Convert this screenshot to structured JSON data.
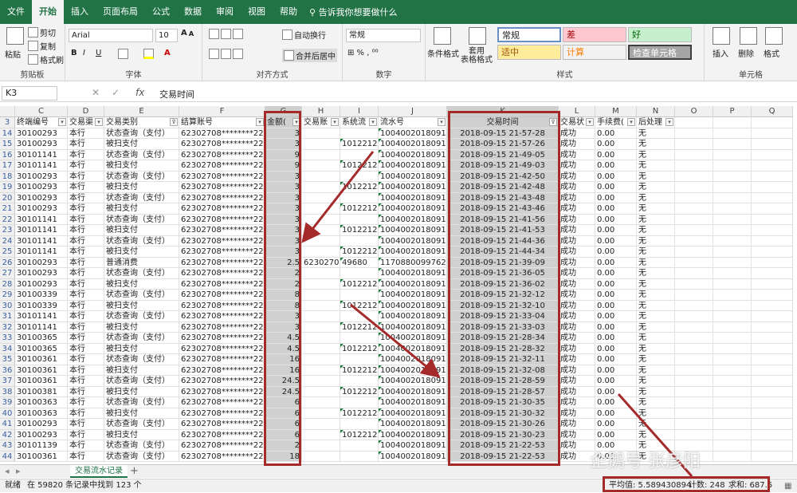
{
  "menu": {
    "tabs": [
      "文件",
      "开始",
      "插入",
      "页面布局",
      "公式",
      "数据",
      "审阅",
      "视图",
      "帮助"
    ],
    "active": 1,
    "tellme": "告诉我你想要做什么"
  },
  "ribbon": {
    "clipboard": {
      "paste": "粘贴",
      "cut": "剪切",
      "copy": "复制",
      "painter": "格式刷",
      "label": "剪贴板"
    },
    "font": {
      "name": "Arial",
      "size": "10",
      "label": "字体",
      "bold": "B",
      "italic": "I",
      "underline": "U"
    },
    "alignment": {
      "wrap": "自动换行",
      "merge": "合并后居中",
      "label": "对齐方式"
    },
    "number": {
      "format": "常规",
      "label": "数字"
    },
    "styles": {
      "cond": "条件格式",
      "table": "套用\n表格格式",
      "normal": "常规",
      "bad": "差",
      "good": "好",
      "neutral": "适中",
      "calc": "计算",
      "check": "检查单元格",
      "label": "样式"
    },
    "cells": {
      "insert": "插入",
      "delete": "删除",
      "format": "格式",
      "label": "单元格"
    }
  },
  "formula_bar": {
    "name_box": "K3",
    "fx": "fx",
    "content": "交易时间"
  },
  "columns": [
    {
      "letter": "C",
      "width": 66
    },
    {
      "letter": "D",
      "width": 46
    },
    {
      "letter": "E",
      "width": 94
    },
    {
      "letter": "F",
      "width": 108
    },
    {
      "letter": "G",
      "width": 46
    },
    {
      "letter": "H",
      "width": 48
    },
    {
      "letter": "I",
      "width": 48
    },
    {
      "letter": "J",
      "width": 86
    },
    {
      "letter": "K",
      "width": 140
    },
    {
      "letter": "L",
      "width": 46
    },
    {
      "letter": "M",
      "width": 52
    },
    {
      "letter": "N",
      "width": 48
    },
    {
      "letter": "O",
      "width": 48
    },
    {
      "letter": "P",
      "width": 48
    },
    {
      "letter": "Q",
      "width": 52
    }
  ],
  "header_row": {
    "row": "3",
    "cells": [
      "终端编号",
      "交易渠",
      "交易类别",
      "结算账号",
      "金额(",
      "交易账",
      "系统流",
      "流水号",
      "交易时间",
      "交易状",
      "手续费(",
      "后处理",
      "",
      "",
      ""
    ]
  },
  "rows": [
    {
      "r": "14",
      "c": [
        "30100293",
        "本行",
        "状态查询（支付）",
        "62302708********228",
        "3",
        "",
        "",
        "10040020180915",
        "2018-09-15 21-57-28",
        "成功",
        "0.00",
        "无"
      ]
    },
    {
      "r": "15",
      "c": [
        "30100293",
        "本行",
        "被扫支付",
        "62302708********228",
        "3",
        "",
        "10122120",
        "10040020180915",
        "2018-09-15 21-57-26",
        "成功",
        "0.00",
        "无"
      ]
    },
    {
      "r": "16",
      "c": [
        "30101141",
        "本行",
        "状态查询（支付）",
        "62302708********228",
        "9",
        "",
        "",
        "10040020180915",
        "2018-09-15 21-49-05",
        "成功",
        "0.00",
        "无"
      ]
    },
    {
      "r": "17",
      "c": [
        "30101141",
        "本行",
        "被扫支付",
        "62302708********228",
        "9",
        "",
        "10122120",
        "10040020180915",
        "2018-09-15 21-49-03",
        "成功",
        "0.00",
        "无"
      ]
    },
    {
      "r": "18",
      "c": [
        "30100293",
        "本行",
        "状态查询（支付）",
        "62302708********228",
        "3",
        "",
        "",
        "10040020180915",
        "2018-09-15 21-42-50",
        "成功",
        "0.00",
        "无"
      ]
    },
    {
      "r": "19",
      "c": [
        "30100293",
        "本行",
        "被扫支付",
        "62302708********228",
        "3",
        "",
        "10122120",
        "10040020180915",
        "2018-09-15 21-42-48",
        "成功",
        "0.00",
        "无"
      ]
    },
    {
      "r": "20",
      "c": [
        "30100293",
        "本行",
        "状态查询（支付）",
        "62302708********228",
        "3",
        "",
        "",
        "10040020180915",
        "2018-09-15 21-43-48",
        "成功",
        "0.00",
        "无"
      ]
    },
    {
      "r": "21",
      "c": [
        "30100293",
        "本行",
        "被扫支付",
        "62302708********228",
        "3",
        "",
        "10122120",
        "10040020180915",
        "2018-09-15 21-43-46",
        "成功",
        "0.00",
        "无"
      ]
    },
    {
      "r": "22",
      "c": [
        "30101141",
        "本行",
        "状态查询（支付）",
        "62302708********228",
        "3",
        "",
        "",
        "10040020180915",
        "2018-09-15 21-41-56",
        "成功",
        "0.00",
        "无"
      ]
    },
    {
      "r": "23",
      "c": [
        "30101141",
        "本行",
        "被扫支付",
        "62302708********228",
        "3",
        "",
        "10122120",
        "10040020180915",
        "2018-09-15 21-41-53",
        "成功",
        "0.00",
        "无"
      ]
    },
    {
      "r": "24",
      "c": [
        "30101141",
        "本行",
        "状态查询（支付）",
        "62302708********228",
        "3",
        "",
        "",
        "10040020180915",
        "2018-09-15 21-44-36",
        "成功",
        "0.00",
        "无"
      ]
    },
    {
      "r": "25",
      "c": [
        "30101141",
        "本行",
        "被扫支付",
        "62302708********228",
        "3",
        "",
        "10122120",
        "10040020180915",
        "2018-09-15 21-44-34",
        "成功",
        "0.00",
        "无"
      ]
    },
    {
      "r": "26",
      "c": [
        "30100293",
        "本行",
        "普通消费",
        "62302708********228",
        "2.5",
        "62302708",
        "49680",
        "117088009976201",
        "2018-09-15 21-39-09",
        "成功",
        "0.00",
        "无"
      ]
    },
    {
      "r": "27",
      "c": [
        "30100293",
        "本行",
        "状态查询（支付）",
        "62302708********228",
        "2",
        "",
        "",
        "10040020180915",
        "2018-09-15 21-36-05",
        "成功",
        "0.00",
        "无"
      ]
    },
    {
      "r": "28",
      "c": [
        "30100293",
        "本行",
        "被扫支付",
        "62302708********228",
        "2",
        "",
        "10122120",
        "10040020180915",
        "2018-09-15 21-36-02",
        "成功",
        "0.00",
        "无"
      ]
    },
    {
      "r": "29",
      "c": [
        "30100339",
        "本行",
        "状态查询（支付）",
        "62302708********228",
        "8",
        "",
        "",
        "10040020180915",
        "2018-09-15 21-32-12",
        "成功",
        "0.00",
        "无"
      ]
    },
    {
      "r": "30",
      "c": [
        "30100339",
        "本行",
        "被扫支付",
        "62302708********228",
        "8",
        "",
        "10122120",
        "10040020180915",
        "2018-09-15 21-32-10",
        "成功",
        "0.00",
        "无"
      ]
    },
    {
      "r": "31",
      "c": [
        "30101141",
        "本行",
        "状态查询（支付）",
        "62302708********228",
        "3",
        "",
        "",
        "10040020180915",
        "2018-09-15 21-33-04",
        "成功",
        "0.00",
        "无"
      ]
    },
    {
      "r": "32",
      "c": [
        "30101141",
        "本行",
        "被扫支付",
        "62302708********228",
        "3",
        "",
        "10122120",
        "10040020180915",
        "2018-09-15 21-33-03",
        "成功",
        "0.00",
        "无"
      ]
    },
    {
      "r": "33",
      "c": [
        "30100365",
        "本行",
        "状态查询（支付）",
        "62302708********228",
        "4.5",
        "",
        "",
        "10040020180915",
        "2018-09-15 21-28-34",
        "成功",
        "0.00",
        "无"
      ]
    },
    {
      "r": "34",
      "c": [
        "30100365",
        "本行",
        "被扫支付",
        "62302708********228",
        "4.5",
        "",
        "10122120",
        "10040020180915",
        "2018-09-15 21-28-32",
        "成功",
        "0.00",
        "无"
      ]
    },
    {
      "r": "35",
      "c": [
        "30100361",
        "本行",
        "状态查询（支付）",
        "62302708********228",
        "16",
        "",
        "",
        "10040020180915",
        "2018-09-15 21-32-11",
        "成功",
        "0.00",
        "无"
      ]
    },
    {
      "r": "36",
      "c": [
        "30100361",
        "本行",
        "被扫支付",
        "62302708********228",
        "16",
        "",
        "10122120",
        "10040020180915",
        "2018-09-15 21-32-08",
        "成功",
        "0.00",
        "无"
      ]
    },
    {
      "r": "37",
      "c": [
        "30100361",
        "本行",
        "状态查询（支付）",
        "62302708********228",
        "24.5",
        "",
        "",
        "10040020180915",
        "2018-09-15 21-28-59",
        "成功",
        "0.00",
        "无"
      ]
    },
    {
      "r": "38",
      "c": [
        "30100381",
        "本行",
        "被扫支付",
        "62302708********228",
        "24.5",
        "",
        "10122120",
        "10040020180915",
        "2018-09-15 21-28-57",
        "成功",
        "0.00",
        "无"
      ]
    },
    {
      "r": "39",
      "c": [
        "30100363",
        "本行",
        "状态查询（支付）",
        "62302708********228",
        "6",
        "",
        "",
        "10040020180915",
        "2018-09-15 21-30-35",
        "成功",
        "0.00",
        "无"
      ]
    },
    {
      "r": "40",
      "c": [
        "30100363",
        "本行",
        "被扫支付",
        "62302708********228",
        "6",
        "",
        "10122120",
        "10040020180915",
        "2018-09-15 21-30-32",
        "成功",
        "0.00",
        "无"
      ]
    },
    {
      "r": "41",
      "c": [
        "30100293",
        "本行",
        "状态查询（支付）",
        "62302708********228",
        "6",
        "",
        "",
        "10040020180915",
        "2018-09-15 21-30-26",
        "成功",
        "0.00",
        "无"
      ]
    },
    {
      "r": "42",
      "c": [
        "30100293",
        "本行",
        "被扫支付",
        "62302708********228",
        "6",
        "",
        "10122120",
        "10040020180915",
        "2018-09-15 21-30-23",
        "成功",
        "0.00",
        "无"
      ]
    },
    {
      "r": "43",
      "c": [
        "30101139",
        "本行",
        "状态查询（支付）",
        "62302708********228",
        "2",
        "",
        "",
        "10040020180915",
        "2018-09-15 21-22-53",
        "成功",
        "0.00",
        "无"
      ]
    },
    {
      "r": "44",
      "c": [
        "30100361",
        "本行",
        "状态查询（支付）",
        "62302708********228",
        "18",
        "",
        "",
        "10040020180915",
        "2018-09-15 21-22-53",
        "成功",
        "0.00",
        "无"
      ]
    }
  ],
  "sheet": {
    "tab": "交易流水记录",
    "add": "+"
  },
  "status": {
    "left": "就绪",
    "found": "在 59820 条记录中找到 123 个",
    "avg": "平均值: 5.589430894",
    "count": "计数: 248",
    "sum": "求和: 687.5"
  },
  "watermark": "企鹅号 张彦阳",
  "colors": {
    "excel_green": "#217346",
    "annotation_red": "#a52a2a"
  }
}
